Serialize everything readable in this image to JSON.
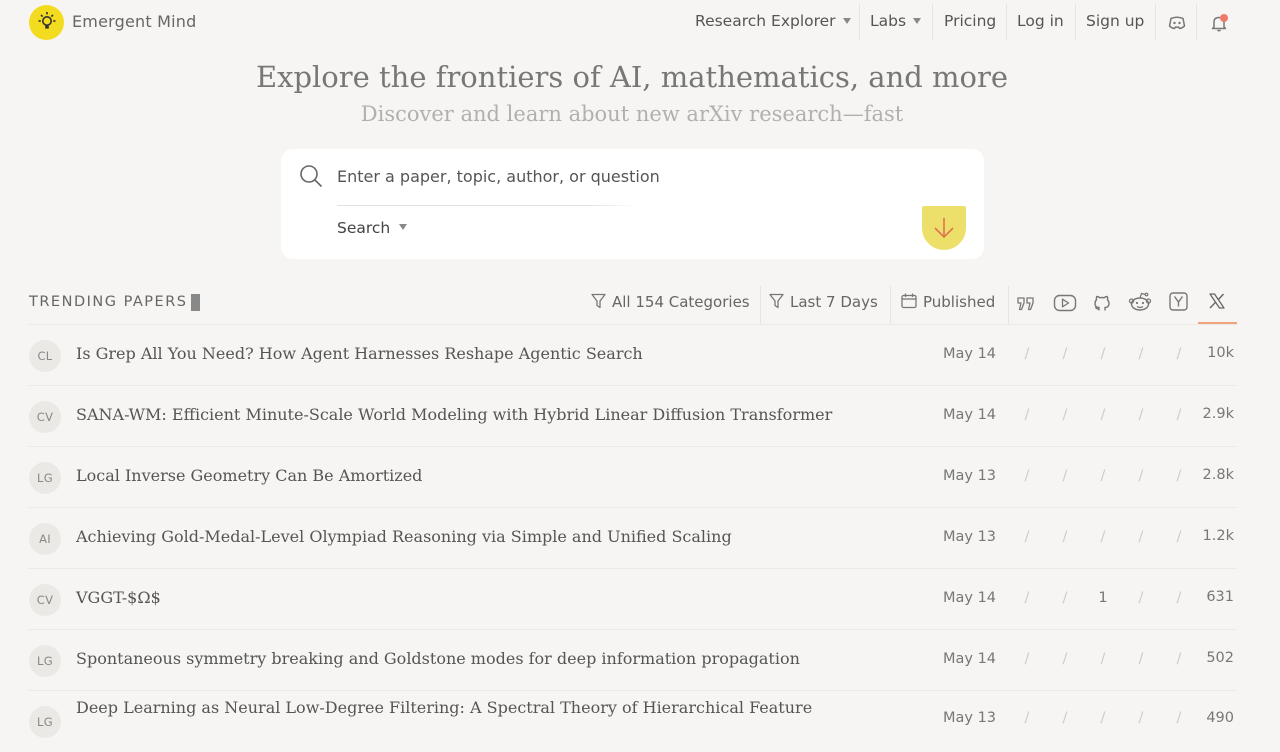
{
  "brand": {
    "name": "Emergent Mind"
  },
  "nav": {
    "items": [
      {
        "label": "Research Explorer",
        "has_dropdown": true
      },
      {
        "label": "Labs",
        "has_dropdown": true
      },
      {
        "label": "Pricing"
      },
      {
        "label": "Log in"
      },
      {
        "label": "Sign up"
      }
    ],
    "icons": [
      "discord-icon",
      "bell-icon"
    ]
  },
  "hero": {
    "title": "Explore the frontiers of AI, mathematics, and more",
    "subtitle": "Discover and learn about new arXiv research—fast"
  },
  "search": {
    "placeholder": "Enter a paper, topic, author, or question",
    "value": "",
    "mode_label": "Search",
    "submit_icon": "arrow-down-icon"
  },
  "trending": {
    "label": "TRENDING PAPERS",
    "filters": {
      "categories": "All 154 Categories",
      "period": "Last 7 Days",
      "sort": "Published"
    },
    "column_icons": [
      "quote-icon",
      "youtube-icon",
      "github-icon",
      "reddit-icon",
      "hackernews-icon",
      "x-icon"
    ],
    "papers": [
      {
        "cat": "CL",
        "title": "Is Grep All You Need? How Agent Harnesses Reshape Agentic Search",
        "date": "May 14",
        "c1": "/",
        "c2": "/",
        "c3": "/",
        "c4": "/",
        "c5": "/",
        "x": "10k"
      },
      {
        "cat": "CV",
        "title": "SANA-WM: Efficient Minute-Scale World Modeling with Hybrid Linear Diffusion Transformer",
        "date": "May 14",
        "c1": "/",
        "c2": "/",
        "c3": "/",
        "c4": "/",
        "c5": "/",
        "x": "2.9k"
      },
      {
        "cat": "LG",
        "title": "Local Inverse Geometry Can Be Amortized",
        "date": "May 13",
        "c1": "/",
        "c2": "/",
        "c3": "/",
        "c4": "/",
        "c5": "/",
        "x": "2.8k"
      },
      {
        "cat": "AI",
        "title": "Achieving Gold-Medal-Level Olympiad Reasoning via Simple and Unified Scaling",
        "date": "May 13",
        "c1": "/",
        "c2": "/",
        "c3": "/",
        "c4": "/",
        "c5": "/",
        "x": "1.2k"
      },
      {
        "cat": "CV",
        "title": "VGGT-$Ω$",
        "date": "May 14",
        "c1": "/",
        "c2": "/",
        "c3": "1",
        "c4": "/",
        "c5": "/",
        "x": "631"
      },
      {
        "cat": "LG",
        "title": "Spontaneous symmetry breaking and Goldstone modes for deep information propagation",
        "date": "May 14",
        "c1": "/",
        "c2": "/",
        "c3": "/",
        "c4": "/",
        "c5": "/",
        "x": "502"
      },
      {
        "cat": "LG",
        "title": "Deep Learning as Neural Low-Degree Filtering: A Spectral Theory of Hierarchical Feature",
        "date": "May 13",
        "c1": "/",
        "c2": "/",
        "c3": "/",
        "c4": "/",
        "c5": "/",
        "x": "490"
      }
    ]
  }
}
